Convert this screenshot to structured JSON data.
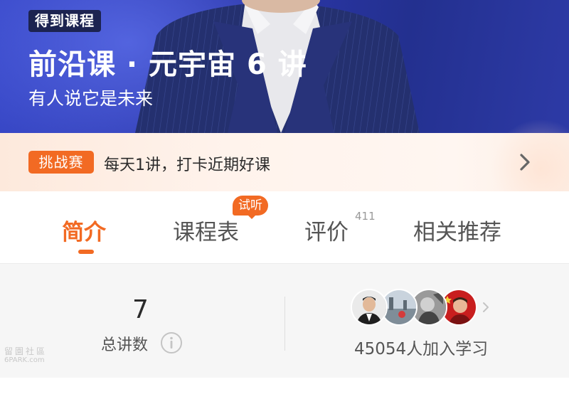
{
  "hero": {
    "badge": "得到课程",
    "title": "前沿课 · 元宇宙 6 讲",
    "subtitle": "有人说它是未来",
    "colors": {
      "background": "#2b36a8",
      "badge_bg": "#1c2350"
    }
  },
  "challenge": {
    "tag": "挑战赛",
    "text": "每天1讲，打卡近期好课",
    "arrow_icon": "chevron-right-icon",
    "colors": {
      "tag_bg": "#f26a23"
    }
  },
  "tabs": {
    "items": [
      {
        "label": "简介",
        "active": true
      },
      {
        "label": "课程表",
        "badge": "试听"
      },
      {
        "label": "评价",
        "count": "411"
      },
      {
        "label": "相关推荐"
      }
    ],
    "accent": "#f26a23"
  },
  "stats": {
    "lectures": {
      "value": "7",
      "label": "总讲数",
      "icon": "info-icon"
    },
    "learners": {
      "text": "45054人加入学习",
      "avatar_count": 4,
      "arrow_icon": "chevron-right-icon"
    }
  },
  "watermark": {
    "line1": "留園社區",
    "line2": "6PARK.com"
  }
}
